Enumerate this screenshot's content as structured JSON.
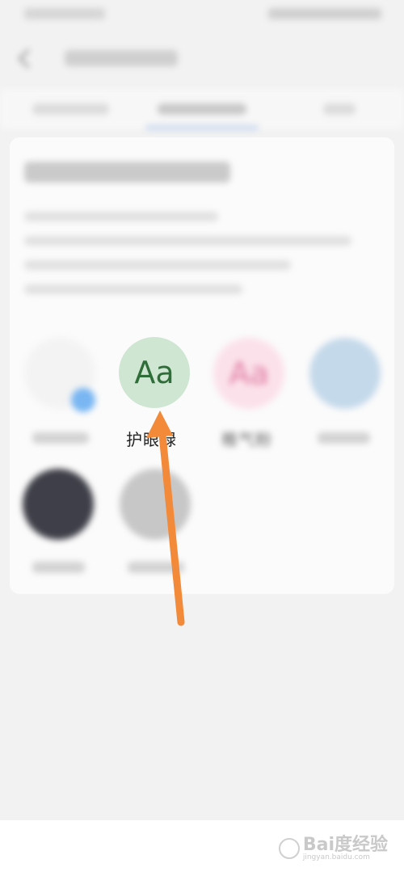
{
  "themes": {
    "green": {
      "sample": "Aa",
      "label": "护眼绿"
    },
    "pink": {
      "sample": "Aa",
      "label": "稚气粉"
    }
  },
  "watermark": {
    "brand": "Bai度经验",
    "url": "jingyan.baidu.com"
  },
  "colors": {
    "arrow": "#f28a3a",
    "green_circle": "#cfe6d3",
    "green_text": "#2f6e38",
    "pink_circle": "#fbe1ea",
    "blue_circle": "#c4d9ea",
    "dark_circle": "#3e3f48"
  }
}
